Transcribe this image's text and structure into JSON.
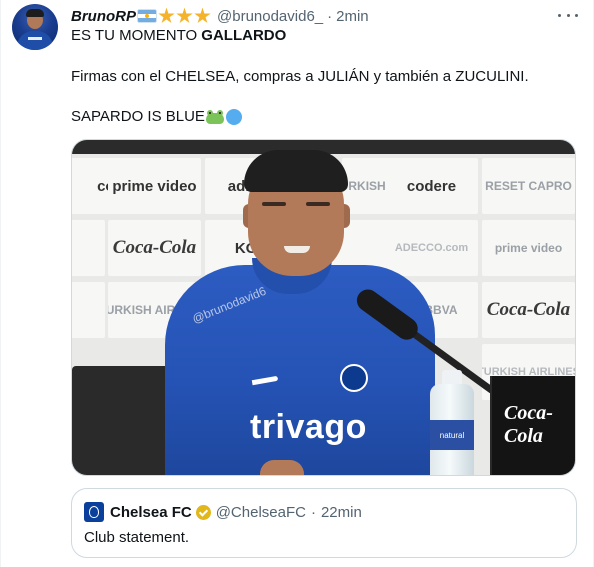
{
  "tweet": {
    "display_name": "BrunoRP",
    "handle": "@brunodavid6_",
    "separator": "·",
    "time": "2min",
    "text_line1_prefix": "ES TU MOMENTO ",
    "text_line1_bold": "GALLARDO",
    "text_line2": "Firmas con el CHELSEA, compras a JULIÁN y también a ZUCULINI.",
    "text_line3": "SAPARDO IS BLUE",
    "badges": [
      "argentina-flag",
      "star",
      "star",
      "star"
    ],
    "emojis": [
      "frog-emoji",
      "blue-circle-emoji"
    ]
  },
  "photo": {
    "watermark": "@brunodavid6",
    "sponsor": "trivago",
    "bottle_label": "natural",
    "cooler_brand": "Coca-Cola",
    "backdrop_logos": [
      "com",
      "prime video",
      "adidas",
      "TURKISH AIRLINES",
      "codere",
      "RESET CAPRO",
      "A",
      "Coca-Cola",
      "KON",
      "",
      "ADECCO.com",
      "prime video",
      "TURKISH AIRLINES",
      "",
      "",
      "LA BBVA",
      "Coca-Cola",
      "TURKISH AIRLINES"
    ]
  },
  "quoted_tweet": {
    "display_name": "Chelsea FC",
    "handle": "@ChelseaFC",
    "separator": "·",
    "time": "22min",
    "text": "Club statement."
  },
  "colors": {
    "text_primary": "#0f1419",
    "text_secondary": "#536471",
    "chelsea_blue": "#0a3f9c",
    "gold_check": "#e2b719",
    "star": "#f4b32a"
  }
}
